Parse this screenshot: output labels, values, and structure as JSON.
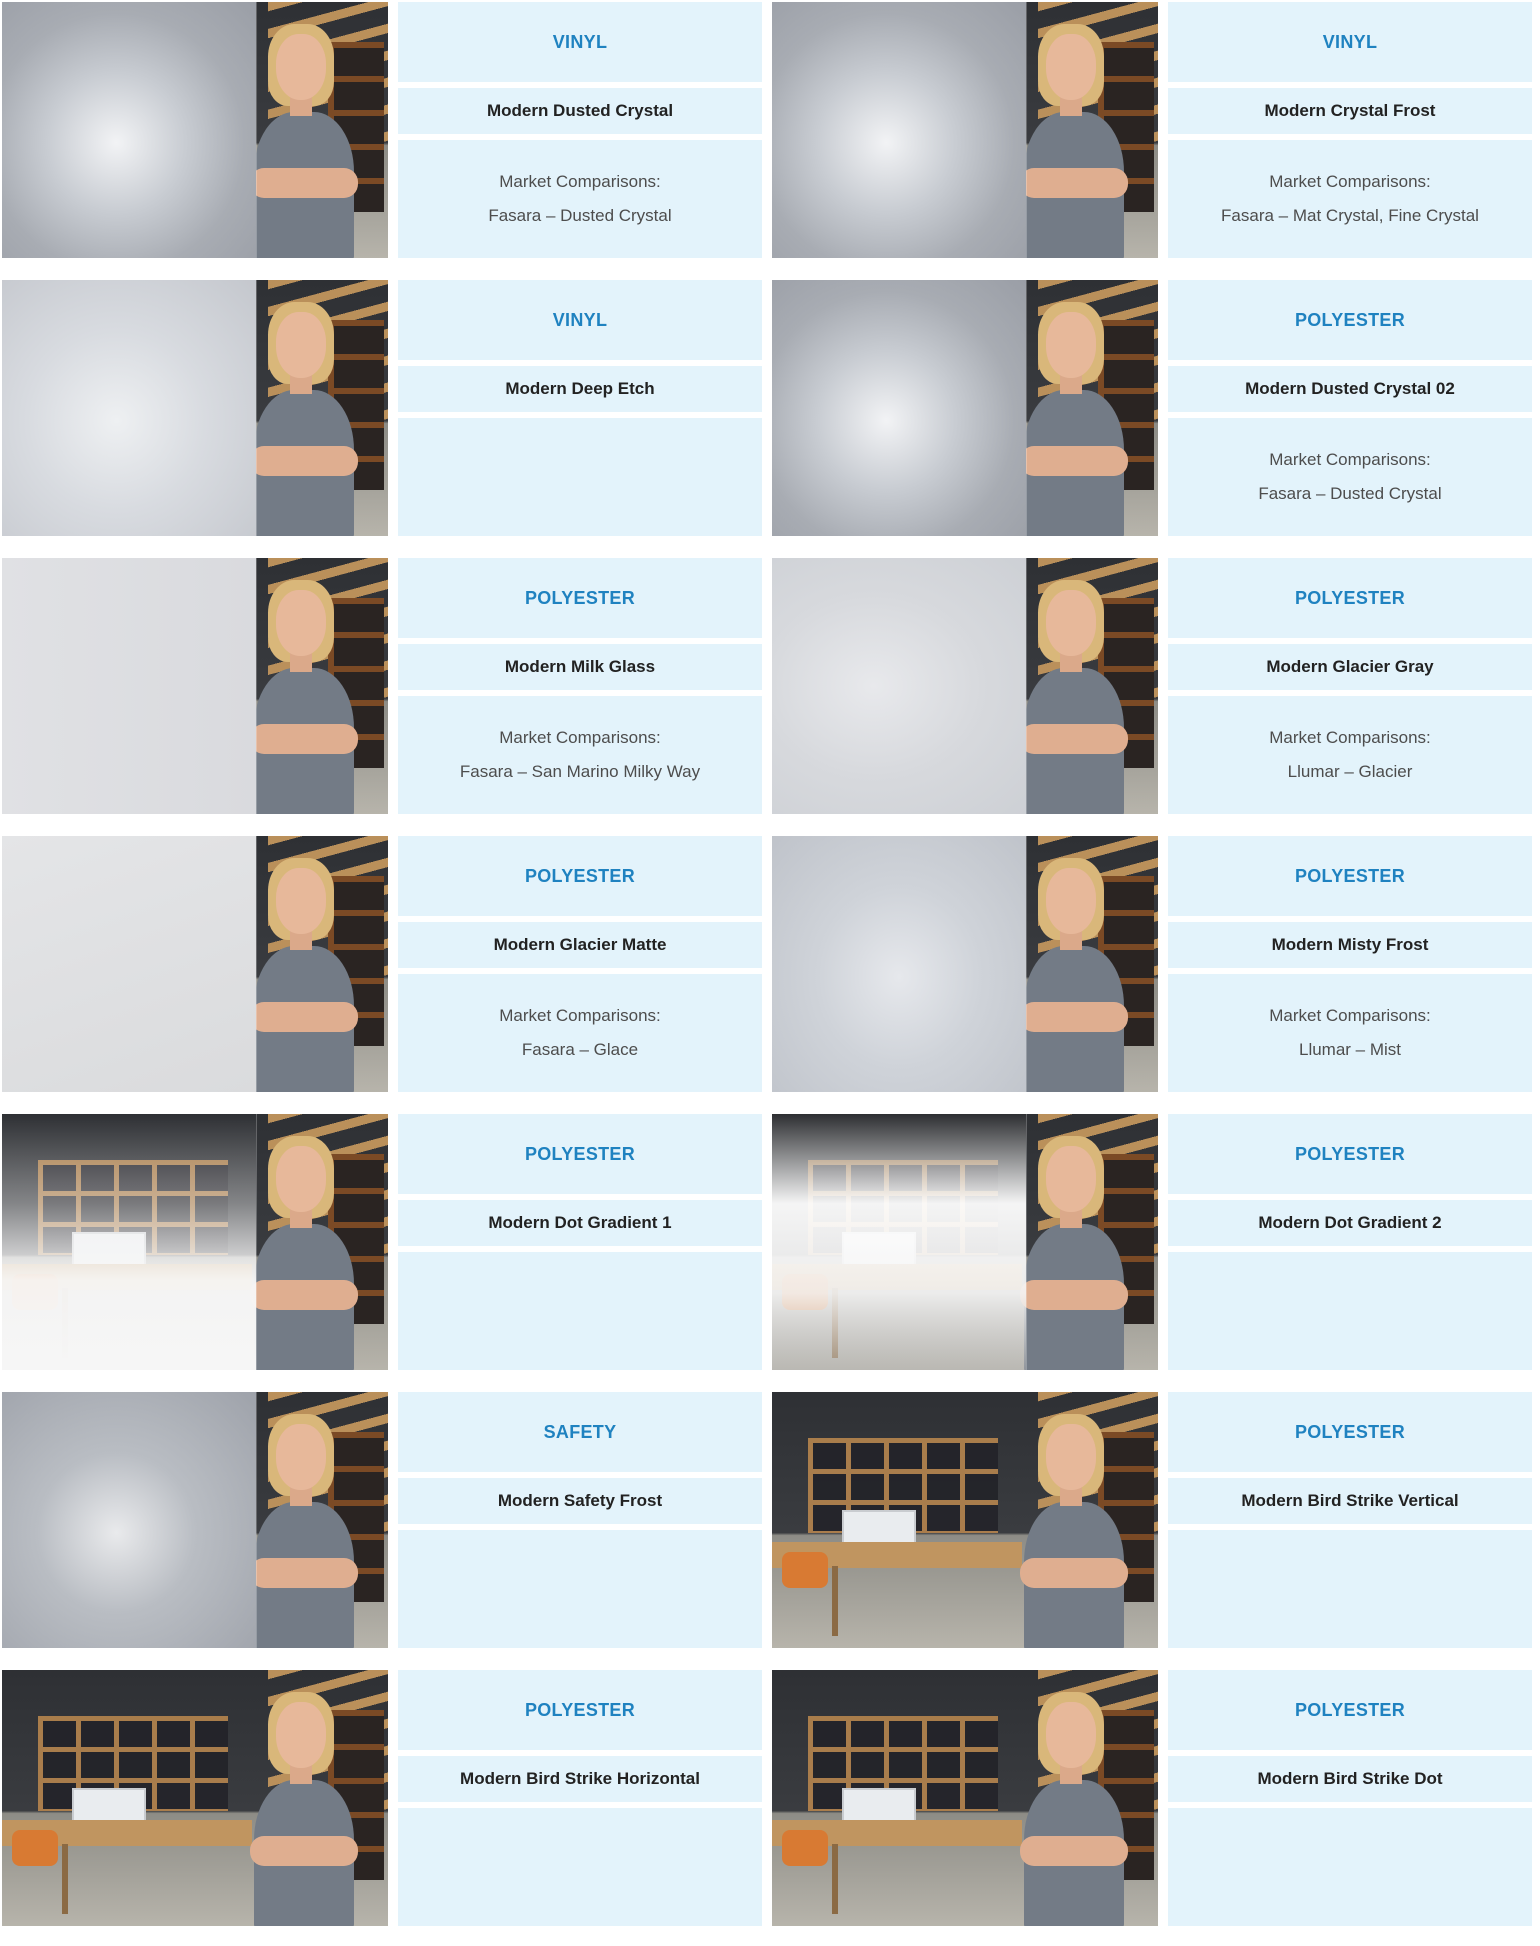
{
  "products": [
    {
      "type": "VINYL",
      "name": "Modern Dusted Crystal",
      "comparison_label": "Market Comparisons:",
      "comparison": "Fasara – Dusted Crystal",
      "effect": "blur"
    },
    {
      "type": "VINYL",
      "name": "Modern Crystal Frost",
      "comparison_label": "Market Comparisons:",
      "comparison": "Fasara – Mat Crystal, Fine Crystal",
      "effect": "blur"
    },
    {
      "type": "VINYL",
      "name": "Modern Deep Etch",
      "comparison_label": "",
      "comparison": "",
      "effect": "soft"
    },
    {
      "type": "POLYESTER",
      "name": "Modern Dusted Crystal 02",
      "comparison_label": "Market Comparisons:",
      "comparison": "Fasara – Dusted Crystal",
      "effect": "blur"
    },
    {
      "type": "POLYESTER",
      "name": "Modern Milk Glass",
      "comparison_label": "Market Comparisons:",
      "comparison": "Fasara – San Marino Milky Way",
      "effect": "milk"
    },
    {
      "type": "POLYESTER",
      "name": "Modern Glacier Gray",
      "comparison_label": "Market Comparisons:",
      "comparison": "Llumar – Glacier",
      "effect": "glacier"
    },
    {
      "type": "POLYESTER",
      "name": "Modern Glacier Matte",
      "comparison_label": "Market Comparisons:",
      "comparison": "Fasara – Glace",
      "effect": "matte"
    },
    {
      "type": "POLYESTER",
      "name": "Modern Misty Frost",
      "comparison_label": "Market Comparisons:",
      "comparison": "Llumar – Mist",
      "effect": "misty"
    },
    {
      "type": "POLYESTER",
      "name": "Modern Dot Gradient 1",
      "comparison_label": "",
      "comparison": "",
      "effect": "grad1"
    },
    {
      "type": "POLYESTER",
      "name": "Modern Dot Gradient 2",
      "comparison_label": "",
      "comparison": "",
      "effect": "grad2"
    },
    {
      "type": "SAFETY",
      "name": "Modern Safety Frost",
      "comparison_label": "",
      "comparison": "",
      "effect": "safety"
    },
    {
      "type": "POLYESTER",
      "name": "Modern Bird Strike Vertical",
      "comparison_label": "",
      "comparison": "",
      "effect": "lines-v"
    },
    {
      "type": "POLYESTER",
      "name": "Modern Bird Strike Horizontal",
      "comparison_label": "",
      "comparison": "",
      "effect": "lines-h"
    },
    {
      "type": "POLYESTER",
      "name": "Modern Bird Strike Dot",
      "comparison_label": "",
      "comparison": "",
      "effect": "dots"
    }
  ],
  "colors": {
    "type_text": "#1f82c0",
    "box_bg": "#e3f3fb",
    "name_text": "#222222",
    "comparison_text": "#4d4d4d"
  }
}
